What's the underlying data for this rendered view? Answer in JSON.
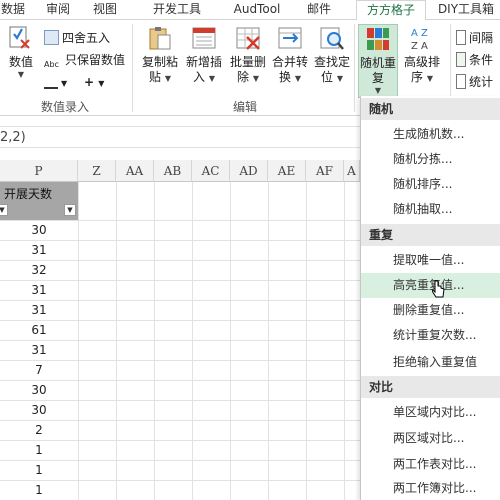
{
  "tabs": [
    "数据",
    "审阅",
    "视图",
    "开发工具",
    "AudTool",
    "邮件",
    "方方格子",
    "DIY工具箱"
  ],
  "active_tab": "方方格子",
  "ribbon": {
    "group_numeric": {
      "label": "数值录入",
      "number_button": "数值",
      "round_label": "四舍五入",
      "keep_value_label": "只保留数值",
      "plus_label": "+"
    },
    "group_edit": {
      "label": "编辑",
      "copy_paste_1": "复制粘",
      "copy_paste_2": "贴",
      "insert_1": "新增插",
      "insert_2": "入",
      "batch_delete_1": "批量删",
      "batch_delete_2": "除",
      "merge_1": "合并转",
      "merge_2": "换",
      "find_1": "查找定",
      "find_2": "位"
    },
    "random_repeat_1": "随机重",
    "random_repeat_2": "复",
    "advanced_sort_1": "高级排",
    "advanced_sort_2": "序",
    "interval_label": "间隔",
    "condition_label": "条件",
    "stats_label": "统计"
  },
  "formula_fragment": "2,2)",
  "sheet": {
    "columns": [
      "P",
      "Z",
      "AA",
      "AB",
      "AC",
      "AD",
      "AE",
      "AF",
      "A"
    ],
    "header_cell": "开展天数",
    "values": [
      "30",
      "31",
      "32",
      "31",
      "31",
      "61",
      "31",
      "7",
      "30",
      "30",
      "2",
      "1",
      "1",
      "1",
      "1",
      "1"
    ]
  },
  "menu": {
    "sections": [
      {
        "title": "随机",
        "items": [
          "生成随机数...",
          "随机分拣...",
          "随机排序...",
          "随机抽取..."
        ]
      },
      {
        "title": "重复",
        "items": [
          "提取唯一值...",
          "高亮重复值...",
          "删除重复值...",
          "统计重复次数...",
          "拒绝输入重复值"
        ]
      },
      {
        "title": "对比",
        "items": [
          "单区域内对比...",
          "两区域对比...",
          "两工作表对比...",
          "两工作簿对比..."
        ]
      }
    ],
    "highlighted_item": "高亮重复值..."
  }
}
